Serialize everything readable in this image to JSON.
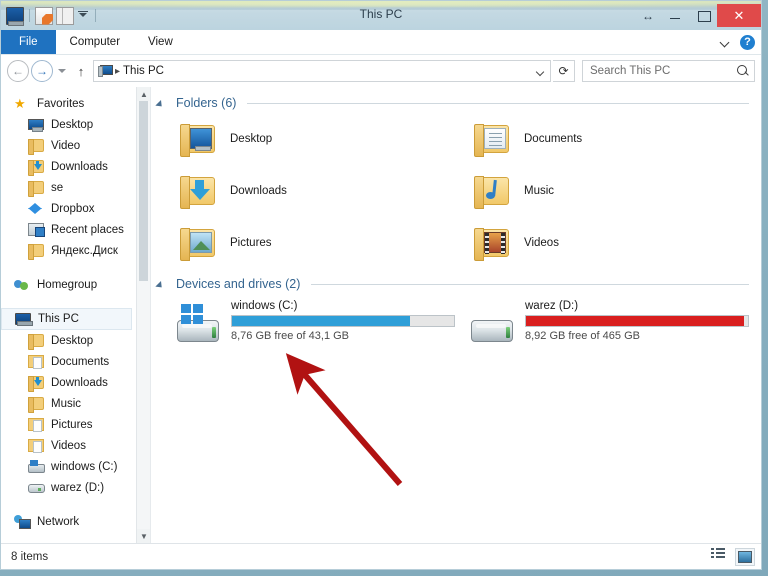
{
  "window": {
    "title": "This PC",
    "quick_access": [
      {
        "name": "this-pc-icon",
        "label": "This PC"
      },
      {
        "name": "properties-icon",
        "label": "Properties"
      },
      {
        "name": "new-folder-icon",
        "label": "New folder"
      },
      {
        "name": "customize-quick-access-icon",
        "label": "Customize Quick Access Toolbar"
      }
    ],
    "controls": {
      "resize_label": "↔",
      "minimize_label": "Minimize",
      "maximize_label": "Maximize",
      "close_label": "Close"
    }
  },
  "ribbon": {
    "tabs": [
      {
        "label": "File",
        "active": true
      },
      {
        "label": "Computer",
        "active": false
      },
      {
        "label": "View",
        "active": false
      }
    ],
    "expand_label": "Expand the Ribbon",
    "help_label": "Help"
  },
  "address_bar": {
    "back_label": "Back",
    "forward_label": "Forward",
    "recent_label": "Recent locations",
    "up_label": "Up",
    "breadcrumb": [
      {
        "label": "This PC"
      }
    ],
    "dropdown_label": "Previous locations",
    "refresh_label": "Refresh",
    "search_placeholder": "Search This PC",
    "search_value": ""
  },
  "sidebar": {
    "groups": [
      {
        "header": {
          "label": "Favorites",
          "icon": "star-icon"
        },
        "items": [
          {
            "label": "Desktop",
            "icon": "monitor-icon"
          },
          {
            "label": "Video",
            "icon": "folder-icon"
          },
          {
            "label": "Downloads",
            "icon": "folder-download-icon"
          },
          {
            "label": "se",
            "icon": "folder-icon"
          },
          {
            "label": "Dropbox",
            "icon": "dropbox-icon"
          },
          {
            "label": "Recent places",
            "icon": "recent-places-icon"
          },
          {
            "label": "Яндекс.Диск",
            "icon": "folder-icon"
          }
        ]
      },
      {
        "header": {
          "label": "Homegroup",
          "icon": "homegroup-icon"
        },
        "items": []
      },
      {
        "header": {
          "label": "This PC",
          "icon": "this-pc-icon",
          "selected": true
        },
        "items": [
          {
            "label": "Desktop",
            "icon": "folder-desktop-icon"
          },
          {
            "label": "Documents",
            "icon": "folder-documents-icon"
          },
          {
            "label": "Downloads",
            "icon": "folder-download-icon"
          },
          {
            "label": "Music",
            "icon": "folder-music-icon"
          },
          {
            "label": "Pictures",
            "icon": "folder-pictures-icon"
          },
          {
            "label": "Videos",
            "icon": "folder-videos-icon"
          },
          {
            "label": "windows (C:)",
            "icon": "hard-drive-windows-icon"
          },
          {
            "label": "warez (D:)",
            "icon": "hard-drive-icon"
          }
        ]
      },
      {
        "header": {
          "label": "Network",
          "icon": "network-icon"
        },
        "items": []
      }
    ]
  },
  "content": {
    "folders_section": {
      "title": "Folders (6)",
      "collapse_label": "Collapse",
      "items": [
        {
          "label": "Desktop",
          "icon": "folder-desktop-icon"
        },
        {
          "label": "Documents",
          "icon": "folder-documents-icon"
        },
        {
          "label": "Downloads",
          "icon": "folder-download-icon"
        },
        {
          "label": "Music",
          "icon": "folder-music-icon"
        },
        {
          "label": "Pictures",
          "icon": "folder-pictures-icon"
        },
        {
          "label": "Videos",
          "icon": "folder-videos-icon"
        }
      ]
    },
    "drives_section": {
      "title": "Devices and drives (2)",
      "collapse_label": "Collapse",
      "items": [
        {
          "label": "windows (C:)",
          "icon": "hard-drive-windows-icon",
          "free_text": "8,76 GB free of 43,1 GB",
          "used_percent": 80,
          "bar_color": "#2f9fd8"
        },
        {
          "label": "warez (D:)",
          "icon": "hard-drive-icon",
          "free_text": "8,92 GB free of 465 GB",
          "used_percent": 98,
          "bar_color": "#d91f1f"
        }
      ]
    }
  },
  "status_bar": {
    "item_count": "8 items",
    "views": [
      {
        "label": "Details view",
        "icon": "details-view-icon",
        "selected": false
      },
      {
        "label": "Large icons view",
        "icon": "large-icons-view-icon",
        "selected": true
      }
    ]
  },
  "annotation": {
    "arrow_color": "#b11212",
    "arrow_label": "arrow pointing to free space text"
  }
}
